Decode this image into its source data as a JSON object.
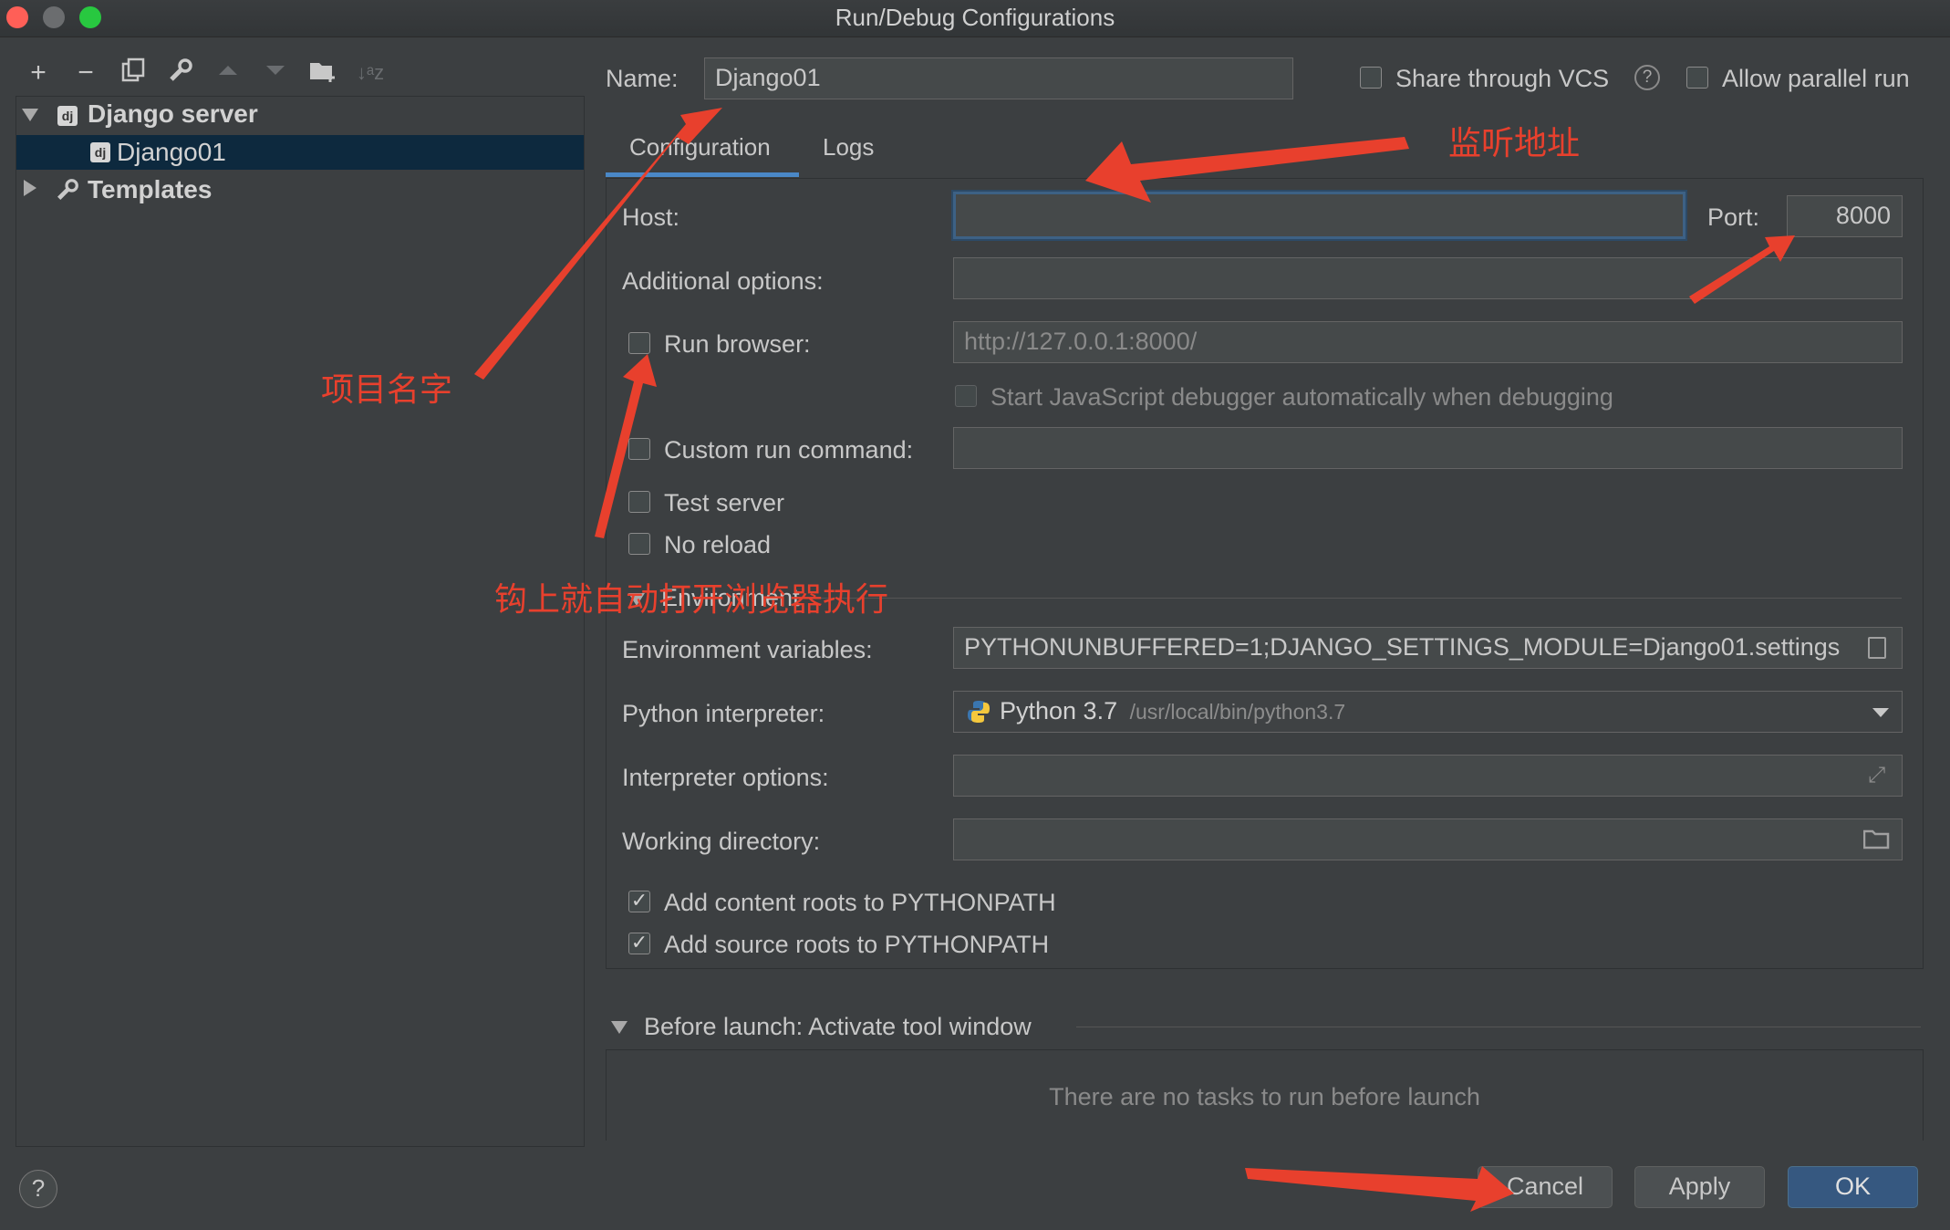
{
  "window": {
    "title": "Run/Debug Configurations"
  },
  "tree": {
    "group_label": "Django server",
    "item_label": "Django01",
    "templates_label": "Templates"
  },
  "form": {
    "name_label": "Name:",
    "name_value": "Django01",
    "share_vcs_label": "Share through VCS",
    "allow_parallel_label": "Allow parallel run",
    "tabs": [
      "Configuration",
      "Logs"
    ],
    "host_label": "Host:",
    "host_value": "",
    "port_label": "Port:",
    "port_value": "8000",
    "additional_options_label": "Additional options:",
    "run_browser_label": "Run browser:",
    "run_browser_url": "http://127.0.0.1:8000/",
    "js_debugger_label": "Start JavaScript debugger automatically when debugging",
    "custom_run_command_label": "Custom run command:",
    "test_server_label": "Test server",
    "no_reload_label": "No reload",
    "environment_section": "Environment",
    "env_vars_label": "Environment variables:",
    "env_vars_value": "PYTHONUNBUFFERED=1;DJANGO_SETTINGS_MODULE=Django01.settings",
    "python_interpreter_label": "Python interpreter:",
    "python_interpreter_name": "Python 3.7",
    "python_interpreter_path": "/usr/local/bin/python3.7",
    "interpreter_options_label": "Interpreter options:",
    "working_directory_label": "Working directory:",
    "content_roots_label": "Add content roots to PYTHONPATH",
    "source_roots_label": "Add source roots to PYTHONPATH",
    "before_launch_label": "Before launch: Activate tool window",
    "no_tasks_text": "There are no tasks to run before launch"
  },
  "buttons": {
    "cancel": "Cancel",
    "apply": "Apply",
    "ok": "OK",
    "help": "?"
  },
  "annotations": {
    "listen_address": "监听地址",
    "project_name": "项目名字",
    "auto_open_browser": "钩上就自动打开浏览器执行"
  },
  "colors": {
    "accent": "#4a88c7",
    "annotation": "#e8402d",
    "primary_button": "#365880"
  }
}
